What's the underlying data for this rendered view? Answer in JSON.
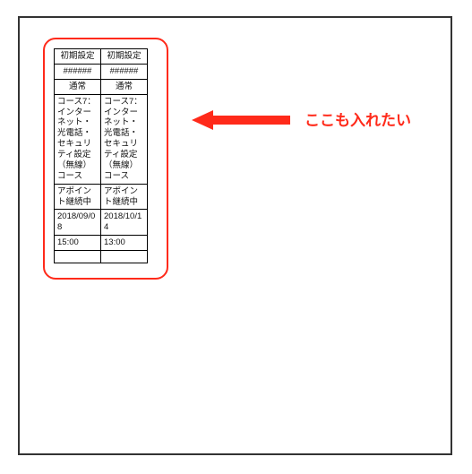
{
  "annotation": {
    "label": "ここも入れたい"
  },
  "table": {
    "headers": [
      "初期設定",
      "初期設定"
    ],
    "row_ids": [
      "######",
      "######"
    ],
    "row_type": [
      "通常",
      "通常"
    ],
    "course": [
      "コース7：インターネット・光電話・セキュリティ設定（無線）コース",
      "コース7：インターネット・光電話・セキュリティ設定（無線）コース"
    ],
    "status": [
      "アポイント継続中",
      "アポイント継続中"
    ],
    "date": [
      "2018/09/08",
      "2018/10/14"
    ],
    "time": [
      "15:00",
      "13:00"
    ]
  }
}
